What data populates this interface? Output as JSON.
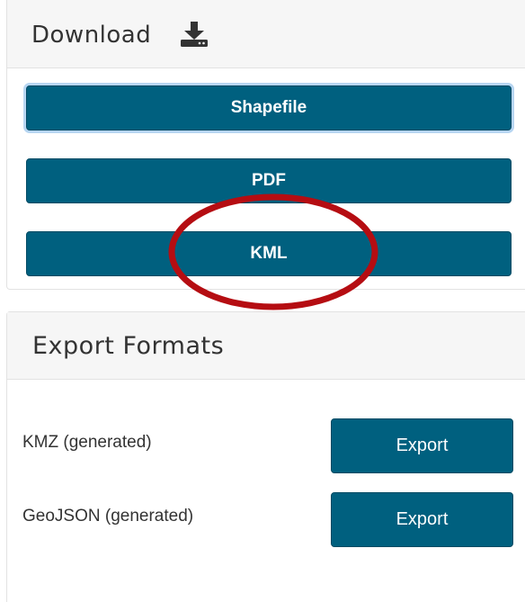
{
  "download_panel": {
    "title": "Download",
    "icon": "download-icon",
    "buttons": {
      "shapefile": "Shapefile",
      "pdf": "PDF",
      "kml": "KML"
    }
  },
  "export_panel": {
    "title": "Export Formats",
    "formats": [
      {
        "label": "KMZ (generated)",
        "button": "Export"
      },
      {
        "label": "GeoJSON (generated)",
        "button": "Export"
      }
    ]
  },
  "colors": {
    "button_bg": "#00607f",
    "highlight": "#b50d12",
    "focus_ring": "#b8d6f2"
  }
}
